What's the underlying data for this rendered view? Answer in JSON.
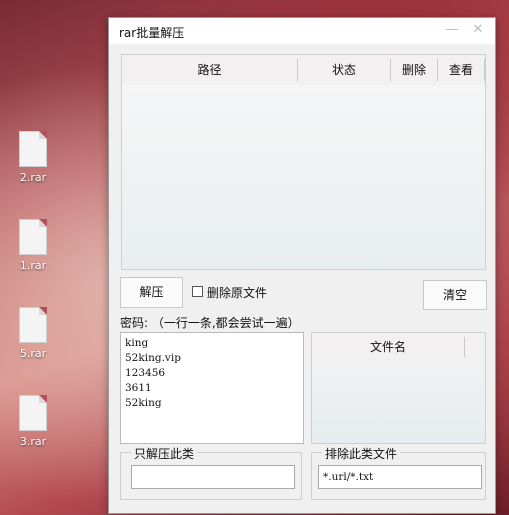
{
  "desktop": {
    "icons": [
      {
        "label": "2.rar"
      },
      {
        "label": "1.rar"
      },
      {
        "label": "5.rar"
      },
      {
        "label": "3.rar"
      }
    ]
  },
  "window": {
    "title": "rar批量解压",
    "minimize_glyph": "—",
    "close_glyph": "✕"
  },
  "list": {
    "columns": [
      "路径",
      "状态",
      "删除",
      "查看"
    ]
  },
  "toolbar": {
    "extract_label": "解压",
    "delete_original_label": "删除原文件",
    "delete_original_checked": false,
    "clear_label": "清空"
  },
  "password": {
    "label": "密码: （一行一条,都会尝试一遍）",
    "lines": [
      "king",
      "52king.vip",
      "123456",
      "3611",
      "52king"
    ]
  },
  "filename_list": {
    "column": "文件名"
  },
  "include_filter": {
    "legend": "只解压此类",
    "value": ""
  },
  "exclude_filter": {
    "legend": "排除此类文件",
    "value": "*.url/*.txt"
  }
}
